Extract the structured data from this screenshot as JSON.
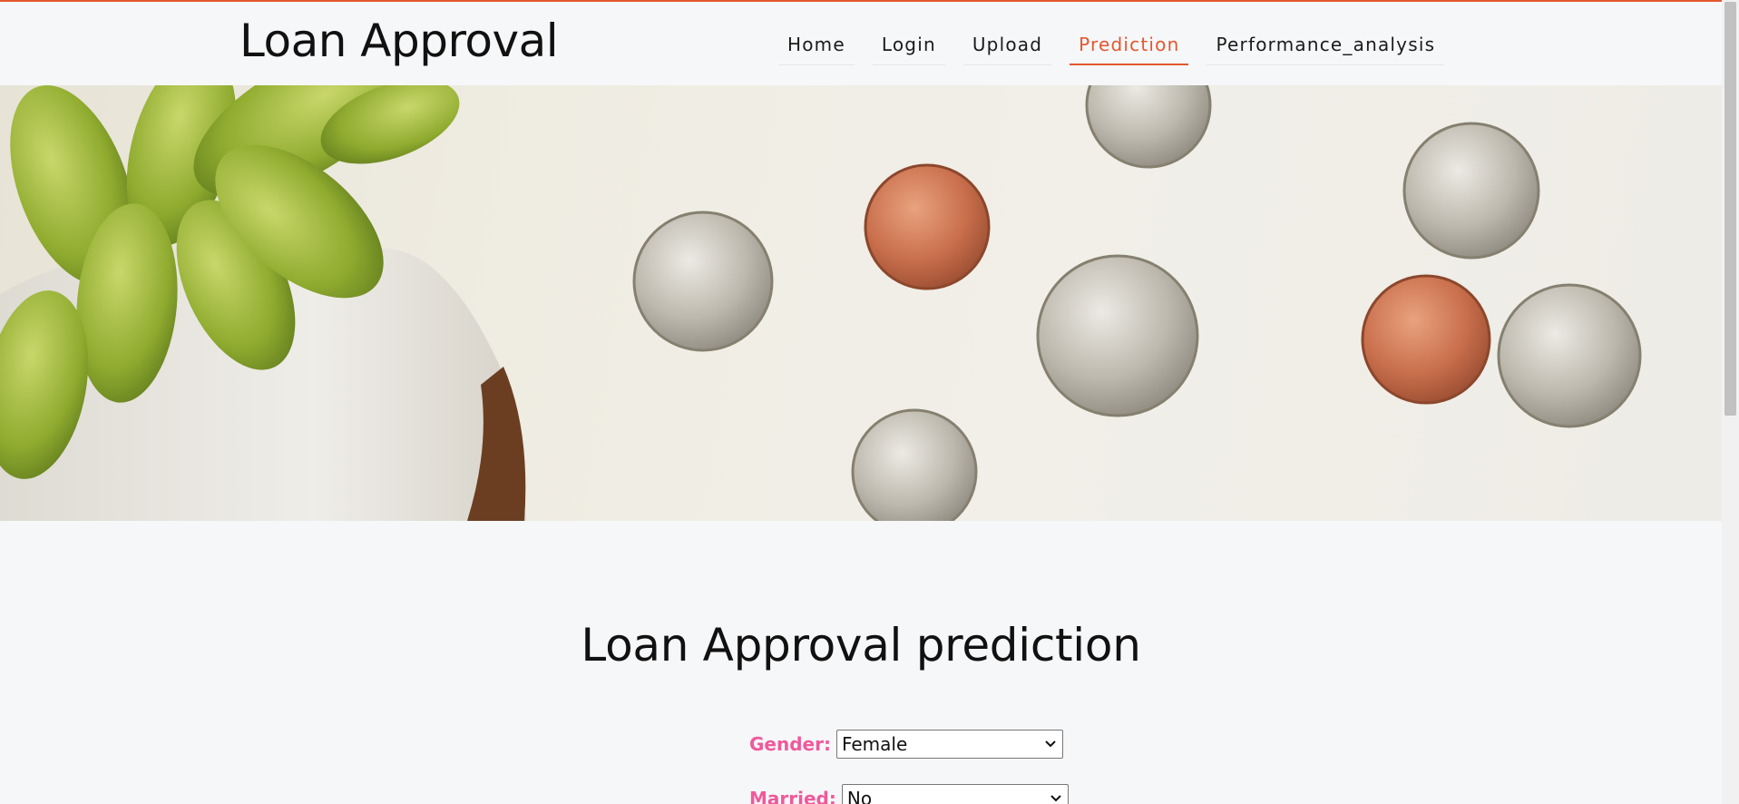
{
  "header": {
    "brand": "Loan Approval",
    "nav": [
      {
        "label": "Home"
      },
      {
        "label": "Login"
      },
      {
        "label": "Upload"
      },
      {
        "label": "Prediction",
        "active": true
      },
      {
        "label": "Performance_analysis"
      }
    ]
  },
  "hero": {
    "image": "plant and coins on white table"
  },
  "main": {
    "title": "Loan Approval prediction",
    "form": {
      "gender": {
        "label": "Gender:",
        "value": "Female"
      },
      "married": {
        "label": "Married:",
        "value": "No"
      }
    }
  },
  "colors": {
    "accent": "#e4572e",
    "label_pink": "#f0599b",
    "background": "#f6f7f9"
  }
}
